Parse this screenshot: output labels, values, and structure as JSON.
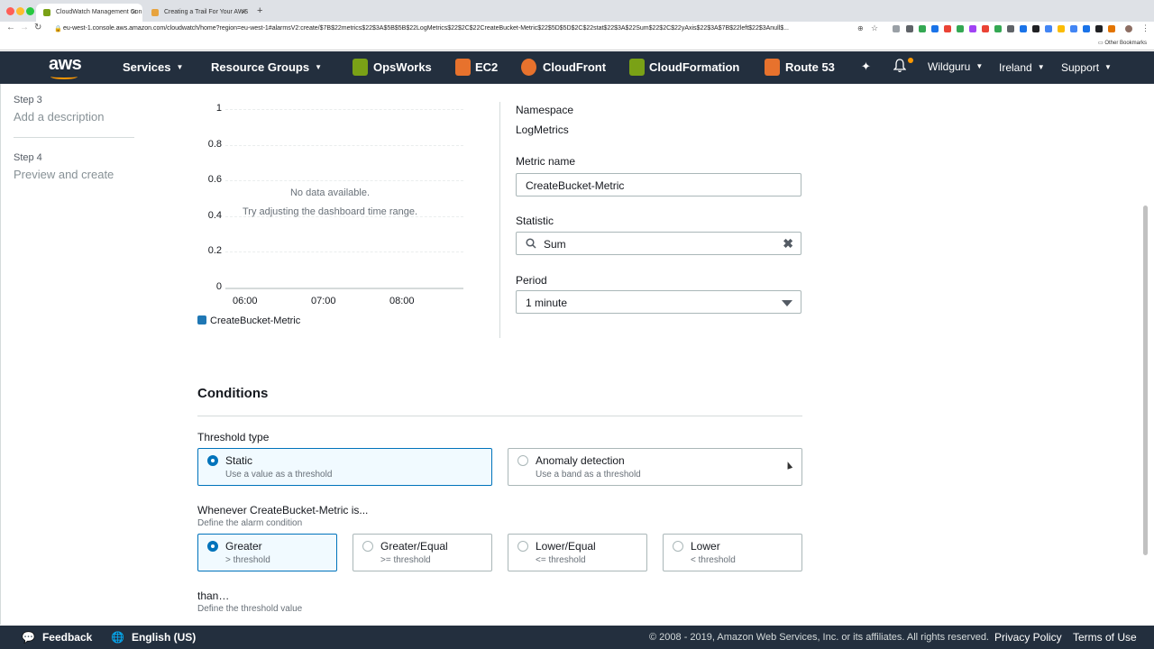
{
  "browser": {
    "tabs": [
      {
        "title": "CloudWatch Management Con",
        "active": true
      },
      {
        "title": "Creating a Trail For Your AWS",
        "active": false
      }
    ],
    "url": "eu-west-1.console.aws.amazon.com/cloudwatch/home?region=eu-west-1#alarmsV2:create/$7B$22metrics$22$3A$5B$5B$22LogMetrics$22$2C$22CreateBucket-Metric$22$5D$5D$2C$22stat$22$3A$22Sum$22$2C$22yAxis$22$3A$7B$22left$22$3Anull$...",
    "other_bookmarks": "Other Bookmarks"
  },
  "awsnav": {
    "logo": "aws",
    "services": "Services",
    "resource_groups": "Resource Groups",
    "shortcuts": [
      "OpsWorks",
      "EC2",
      "CloudFront",
      "CloudFormation",
      "Route 53"
    ],
    "user": "Wildguru",
    "region": "Ireland",
    "support": "Support"
  },
  "steps": [
    {
      "label": "Step 3",
      "title": "Add a description"
    },
    {
      "label": "Step 4",
      "title": "Preview and create"
    }
  ],
  "chart_data": {
    "type": "line",
    "title": "",
    "xlabel": "",
    "ylabel": "",
    "categories": [
      "06:00",
      "07:00",
      "08:00"
    ],
    "y_ticks": [
      "1",
      "0.8",
      "0.6",
      "0.4",
      "0.2",
      "0"
    ],
    "ylim": [
      0,
      1
    ],
    "series": [
      {
        "name": "CreateBucket-Metric",
        "values": []
      }
    ],
    "empty_message": "No data available.",
    "empty_hint": "Try adjusting the dashboard time range.",
    "legend_color": "#1f77b4"
  },
  "metric": {
    "namespace_label": "Namespace",
    "namespace_value": "LogMetrics",
    "metric_name_label": "Metric name",
    "metric_name_value": "CreateBucket-Metric",
    "statistic_label": "Statistic",
    "statistic_value": "Sum",
    "period_label": "Period",
    "period_value": "1 minute"
  },
  "conditions": {
    "title": "Conditions",
    "threshold_type_label": "Threshold type",
    "threshold_types": [
      {
        "title": "Static",
        "sub": "Use a value as a threshold",
        "selected": true
      },
      {
        "title": "Anomaly detection",
        "sub": "Use a band as a threshold",
        "selected": false
      }
    ],
    "whenever_label": "Whenever CreateBucket-Metric is...",
    "whenever_hint": "Define the alarm condition",
    "operators": [
      {
        "title": "Greater",
        "sub": "> threshold",
        "selected": true
      },
      {
        "title": "Greater/Equal",
        "sub": ">= threshold",
        "selected": false
      },
      {
        "title": "Lower/Equal",
        "sub": "<= threshold",
        "selected": false
      },
      {
        "title": "Lower",
        "sub": "< threshold",
        "selected": false
      }
    ],
    "than_label": "than…",
    "than_hint": "Define the threshold value"
  },
  "footer": {
    "feedback": "Feedback",
    "language": "English (US)",
    "copyright": "© 2008 - 2019, Amazon Web Services, Inc. or its affiliates. All rights reserved.",
    "privacy": "Privacy Policy",
    "terms": "Terms of Use"
  },
  "colors": {
    "accent": "#0073bb",
    "nav_bg": "#232f3e",
    "brand_orange": "#ff9900"
  }
}
